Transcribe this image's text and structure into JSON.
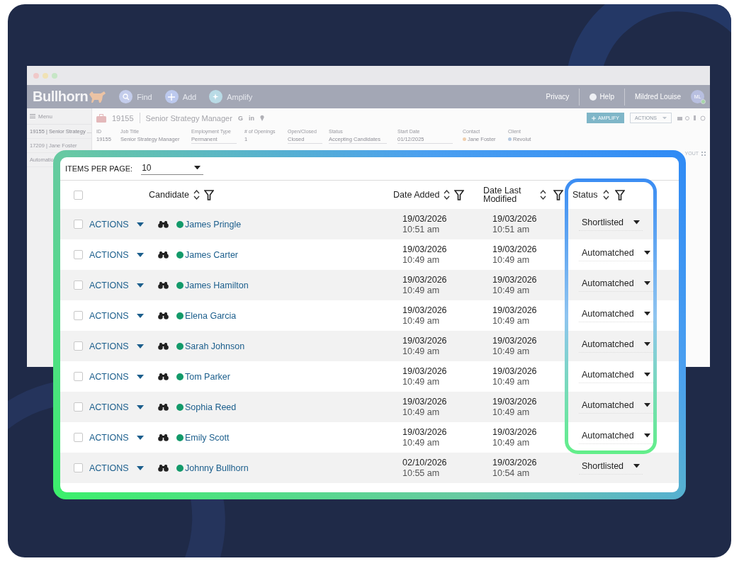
{
  "app": {
    "logo": "Bullhorn",
    "nav": [
      {
        "label": "Find",
        "kind": "search"
      },
      {
        "label": "Add",
        "kind": "add"
      },
      {
        "label": "Amplify",
        "kind": "sparkle"
      }
    ],
    "nav_right": {
      "privacy": "Privacy",
      "help": "Help",
      "user": "Mildred Louise",
      "avatar": "ML"
    },
    "sidebar": {
      "menu": "Menu",
      "items": [
        "19155 | Senior Strategy ...",
        "17209 | Jane Foster",
        "Automatio"
      ]
    },
    "record": {
      "id": "19155",
      "title": "Senior Strategy Manager",
      "tags": [
        "G",
        "in"
      ],
      "amplify": "AMPLIFY",
      "actions": "ACTIONS",
      "fields": [
        {
          "label": "ID",
          "value": "19155",
          "kind": "plain"
        },
        {
          "label": "Job Title",
          "value": "Senior Strategy Manager",
          "kind": "plain"
        },
        {
          "label": "Employment Type",
          "value": "Permanent",
          "kind": "select"
        },
        {
          "label": "# of Openings",
          "value": "1",
          "kind": "plain"
        },
        {
          "label": "Open/Closed",
          "value": "Closed",
          "kind": "select"
        },
        {
          "label": "Status",
          "value": "Accepting Candidates",
          "kind": "select"
        },
        {
          "label": "Start Date",
          "value": "01/12/2025",
          "kind": "date"
        },
        {
          "label": "Contact",
          "value": "Jane Foster",
          "kind": "person"
        },
        {
          "label": "Client",
          "value": "Revolut",
          "kind": "company"
        }
      ],
      "layout": "YOUT"
    }
  },
  "table": {
    "select_all_checked": false,
    "items_per_page_label": "ITEMS PER PAGE:",
    "items_per_page": "10",
    "columns": [
      "Candidate",
      "Date Added",
      "Date Last Modified",
      "Status"
    ],
    "rows": [
      {
        "checked": false,
        "action": "ACTIONS",
        "name": "James Pringle",
        "added": "19/03/2026",
        "added_time": "10:51 am",
        "modified": "19/03/2026",
        "modified_time": "10:51 am",
        "status": "Shortlisted"
      },
      {
        "checked": false,
        "action": "ACTIONS",
        "name": "James Carter",
        "added": "19/03/2026",
        "added_time": "10:49 am",
        "modified": "19/03/2026",
        "modified_time": "10:49 am",
        "status": "Automatched"
      },
      {
        "checked": false,
        "action": "ACTIONS",
        "name": "James Hamilton",
        "added": "19/03/2026",
        "added_time": "10:49 am",
        "modified": "19/03/2026",
        "modified_time": "10:49 am",
        "status": "Automatched"
      },
      {
        "checked": false,
        "action": "ACTIONS",
        "name": "Elena Garcia",
        "added": "19/03/2026",
        "added_time": "10:49 am",
        "modified": "19/03/2026",
        "modified_time": "10:49 am",
        "status": "Automatched"
      },
      {
        "checked": false,
        "action": "ACTIONS",
        "name": "Sarah Johnson",
        "added": "19/03/2026",
        "added_time": "10:49 am",
        "modified": "19/03/2026",
        "modified_time": "10:49 am",
        "status": "Automatched"
      },
      {
        "checked": false,
        "action": "ACTIONS",
        "name": "Tom Parker",
        "added": "19/03/2026",
        "added_time": "10:49 am",
        "modified": "19/03/2026",
        "modified_time": "10:49 am",
        "status": "Automatched"
      },
      {
        "checked": false,
        "action": "ACTIONS",
        "name": "Sophia Reed",
        "added": "19/03/2026",
        "added_time": "10:49 am",
        "modified": "19/03/2026",
        "modified_time": "10:49 am",
        "status": "Automatched"
      },
      {
        "checked": false,
        "action": "ACTIONS",
        "name": "Emily Scott",
        "added": "19/03/2026",
        "added_time": "10:49 am",
        "modified": "19/03/2026",
        "modified_time": "10:49 am",
        "status": "Automatched"
      },
      {
        "checked": false,
        "action": "ACTIONS",
        "name": "Johnny Bullhorn",
        "added": "02/10/2026",
        "added_time": "10:55 am",
        "modified": "19/03/2026",
        "modified_time": "10:54 am",
        "status": "Shortlisted"
      }
    ]
  }
}
